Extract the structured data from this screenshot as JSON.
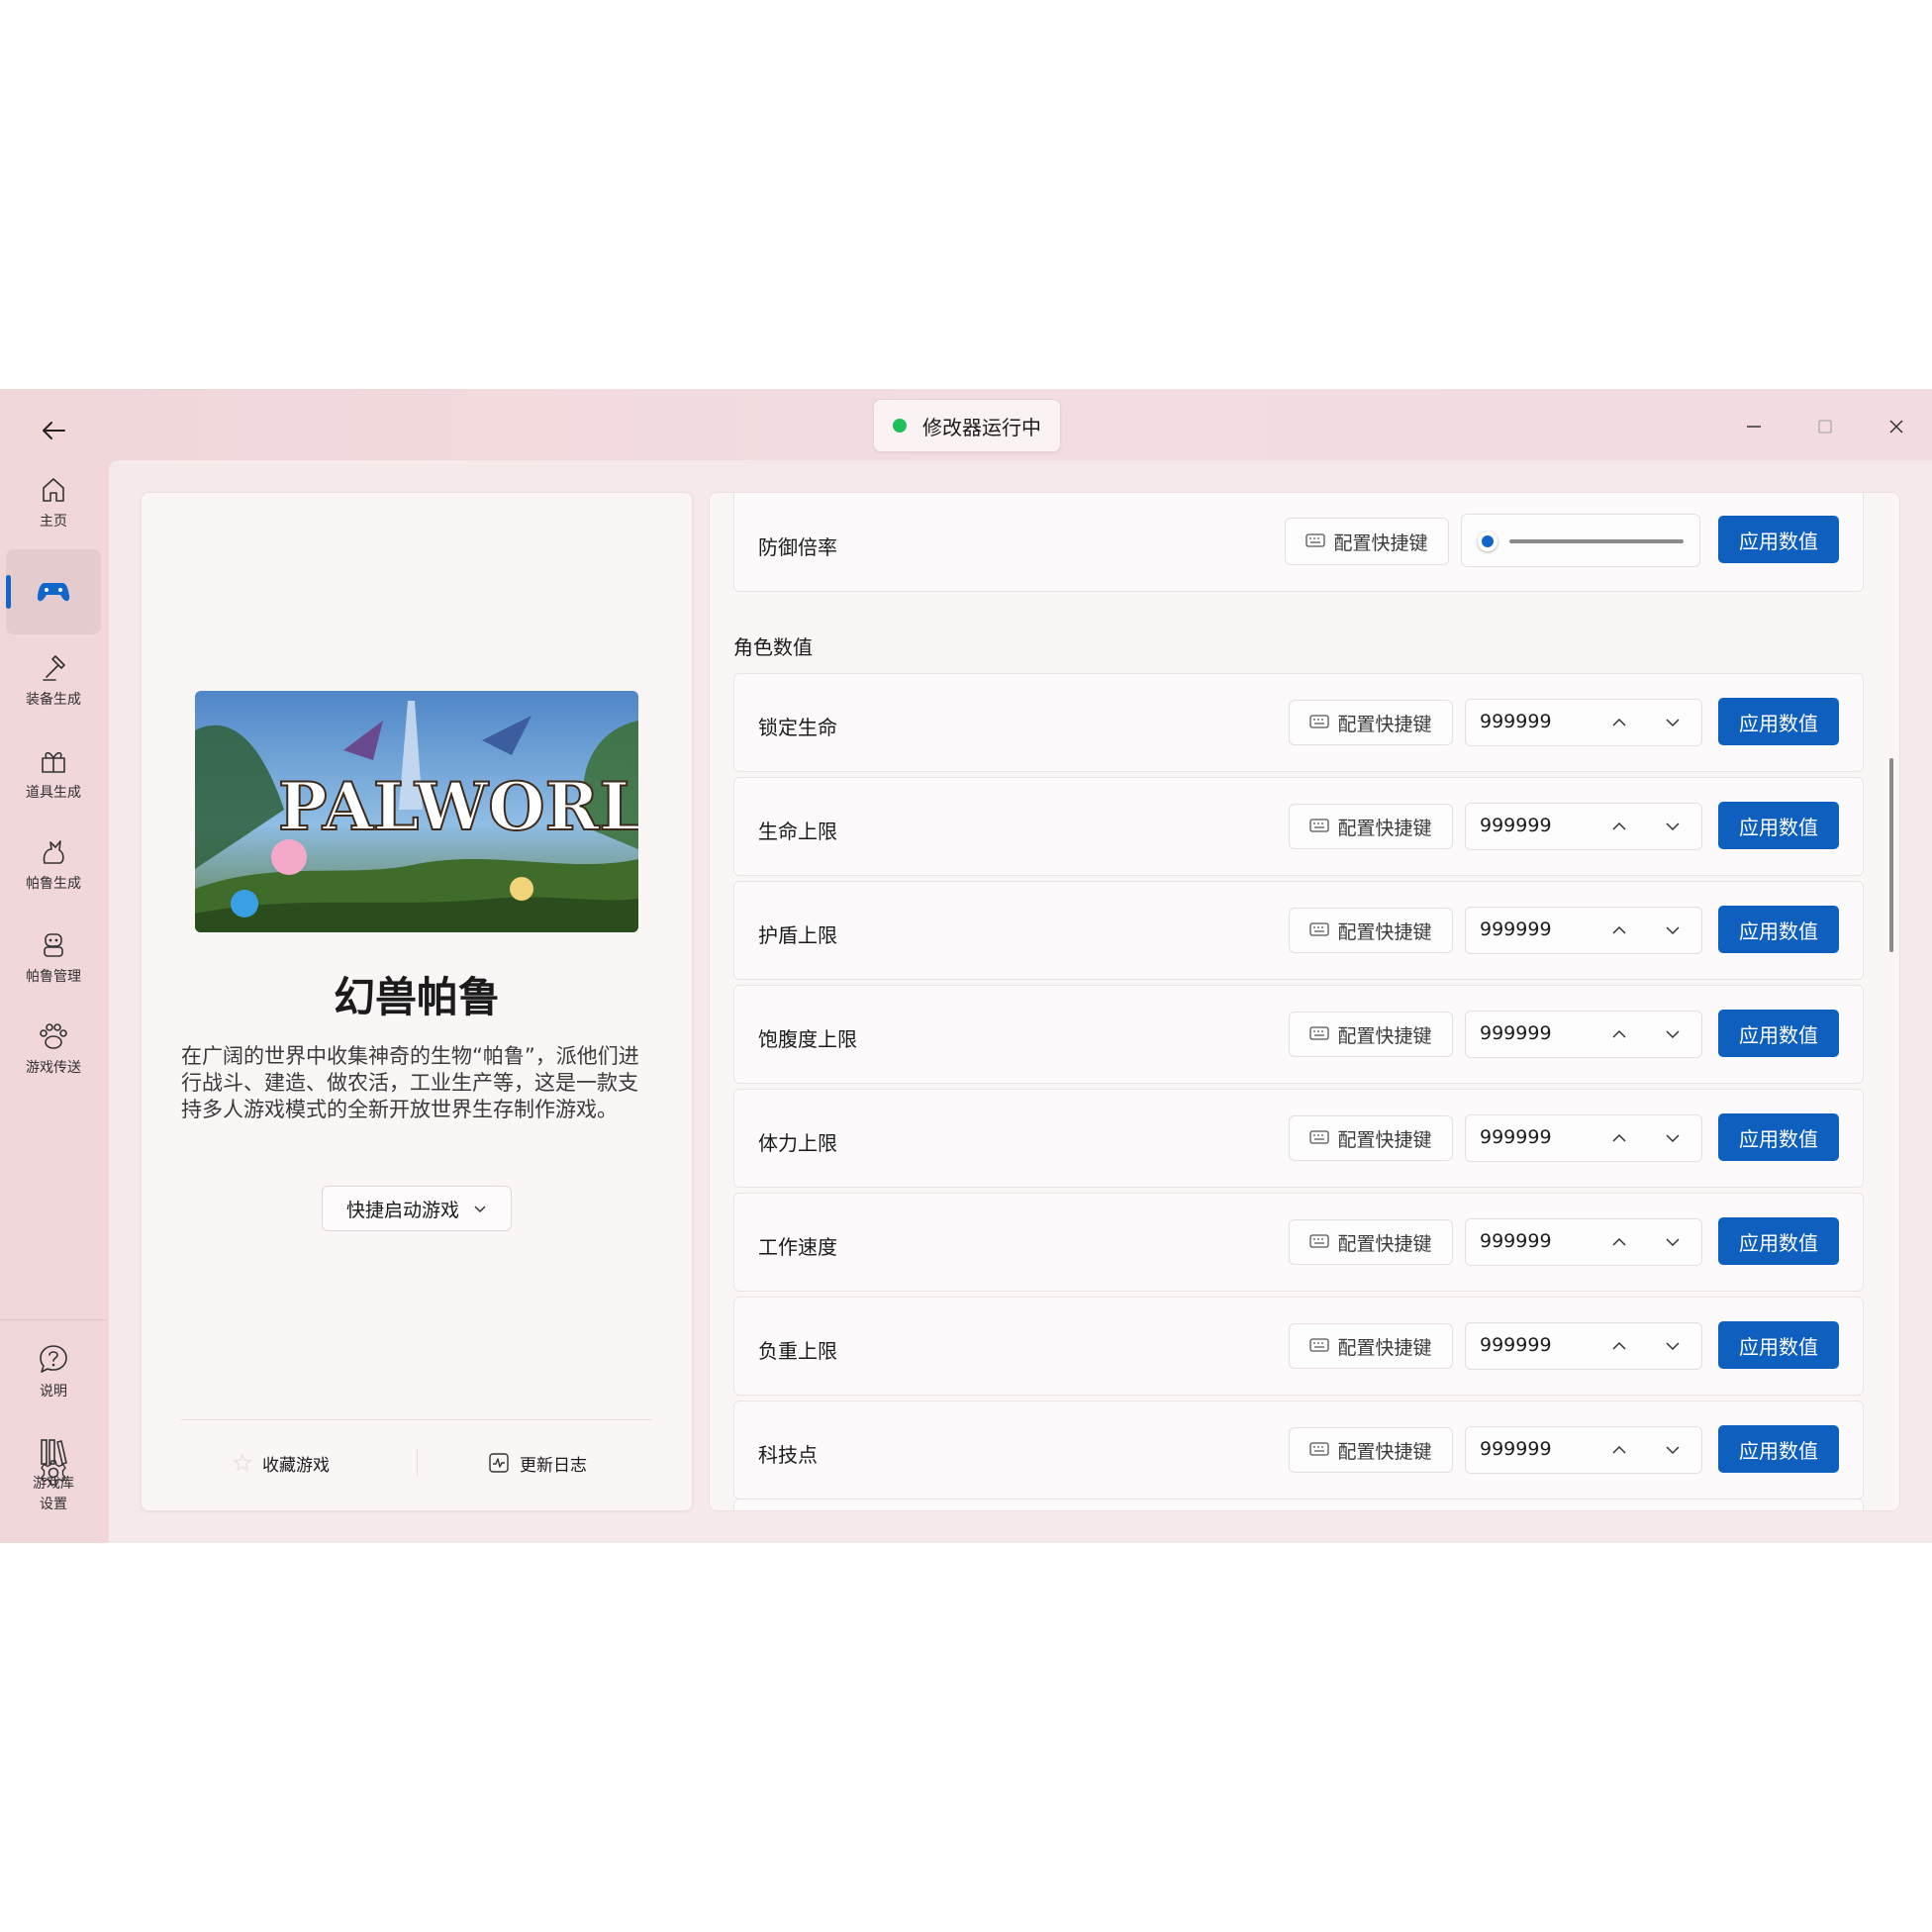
{
  "titlebar": {
    "status_text": "修改器运行中",
    "status_color": "#1ec05a"
  },
  "sidebar": {
    "items": [
      {
        "label": "主页",
        "icon": "home-icon"
      },
      {
        "label": "",
        "icon": "gamepad-icon",
        "active": true
      },
      {
        "label": "装备生成",
        "icon": "hammer-icon"
      },
      {
        "label": "道具生成",
        "icon": "gift-icon"
      },
      {
        "label": "帕鲁生成",
        "icon": "pal-icon"
      },
      {
        "label": "帕鲁管理",
        "icon": "robot-icon"
      },
      {
        "label": "游戏传送",
        "icon": "paw-icon"
      }
    ],
    "bottom_items": [
      {
        "label": "说明",
        "icon": "help-icon"
      },
      {
        "label": "游戏库",
        "icon": "library-icon"
      },
      {
        "label": "设置",
        "icon": "gear-icon"
      }
    ]
  },
  "game": {
    "cover_text": "PALWORLD",
    "title": "幻兽帕鲁",
    "description": "在广阔的世界中收集神奇的生物“帕鲁”，派他们进行战斗、建造、做农活，工业生产等，这是一款支持多人游戏模式的全新开放世界生存制作游戏。",
    "launch_label": "快捷启动游戏",
    "favorite_label": "收藏游戏",
    "changelog_label": "更新日志"
  },
  "settings": {
    "hotkey_label": "配置快捷键",
    "apply_label": "应用数值",
    "accent_color": "#0f5fbf",
    "top_row": {
      "label": "防御倍率",
      "slider_fraction": 0.02
    },
    "section_title": "角色数值",
    "rows": [
      {
        "label": "锁定生命",
        "value": "999999"
      },
      {
        "label": "生命上限",
        "value": "999999"
      },
      {
        "label": "护盾上限",
        "value": "999999"
      },
      {
        "label": "饱腹度上限",
        "value": "999999"
      },
      {
        "label": "体力上限",
        "value": "999999"
      },
      {
        "label": "工作速度",
        "value": "999999"
      },
      {
        "label": "负重上限",
        "value": "999999"
      },
      {
        "label": "科技点",
        "value": "999999"
      }
    ]
  }
}
